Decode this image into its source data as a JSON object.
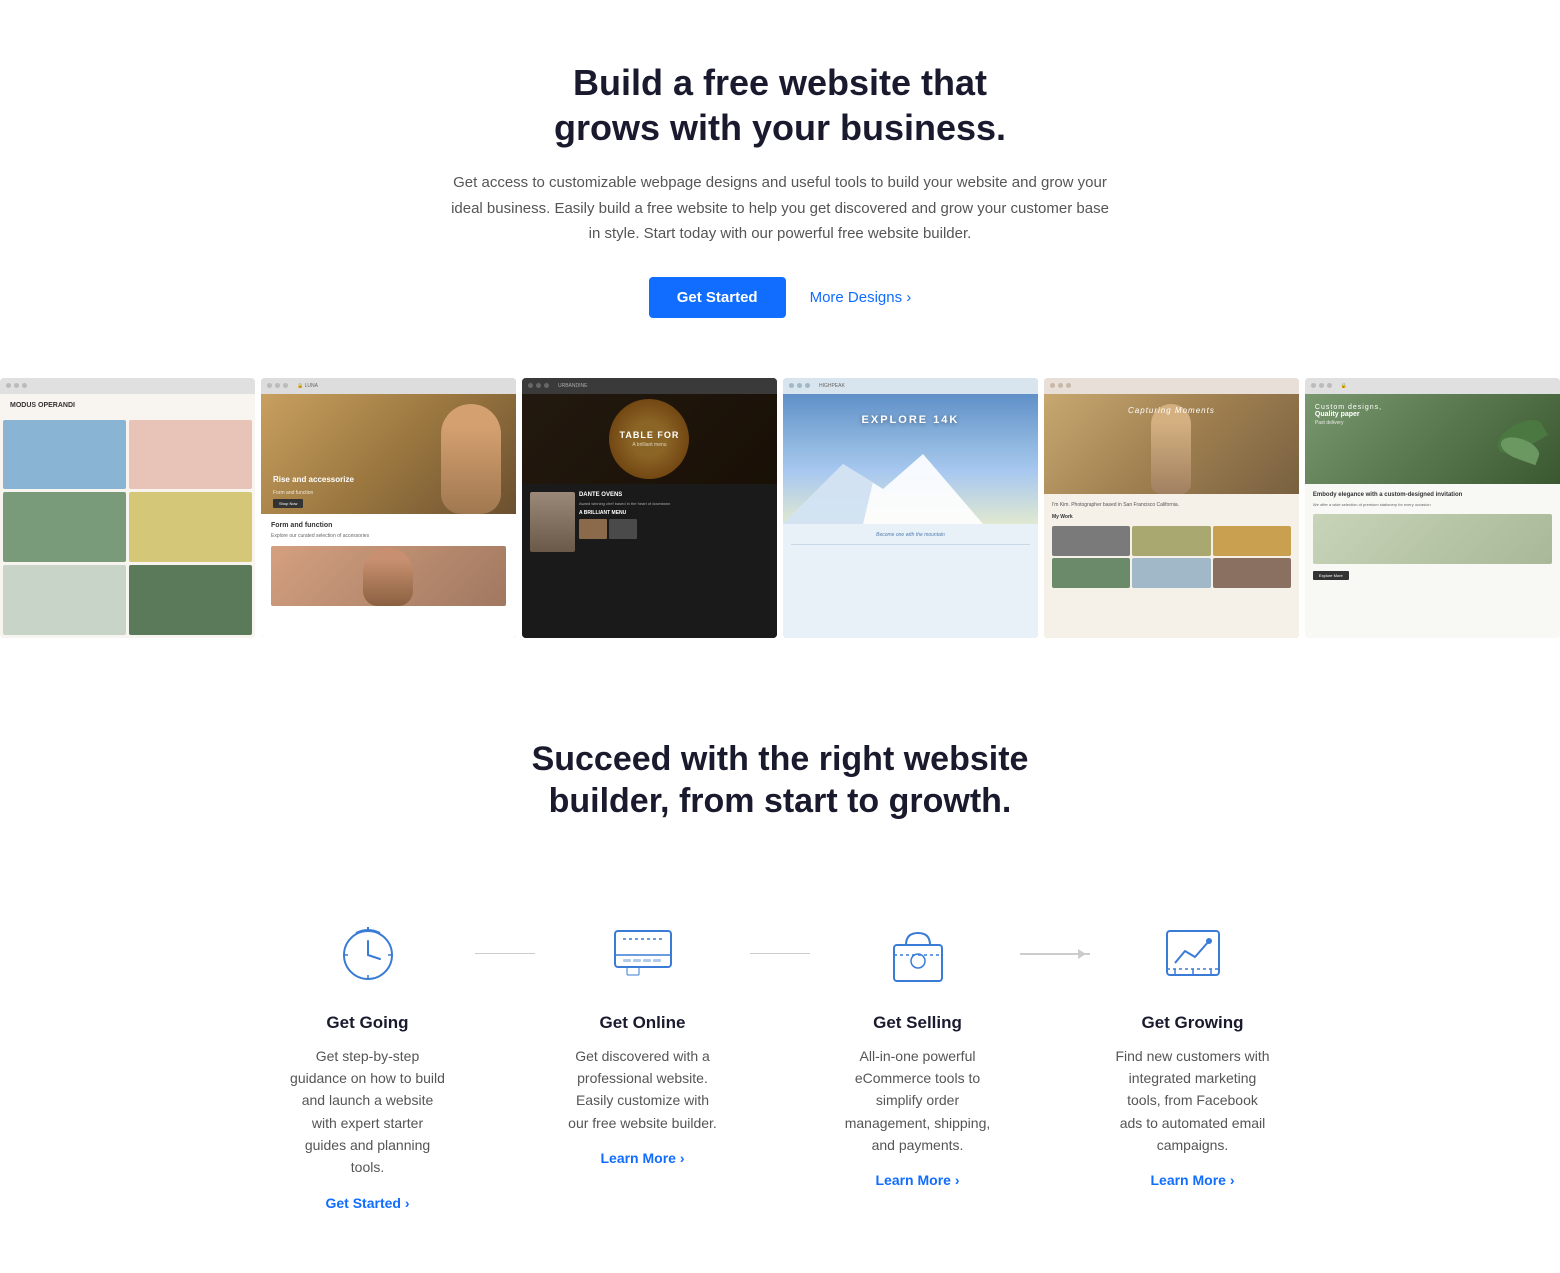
{
  "hero": {
    "title_line1": "Build a free website that",
    "title_line2": "grows with your business.",
    "description": "Get access to customizable webpage designs and useful tools to build your website and grow your ideal business. Easily build a free website to help you get discovered and grow your customer base in style. Start today with our powerful free website builder.",
    "cta_primary": "Get Started",
    "cta_secondary": "More Designs ›"
  },
  "templates": [
    {
      "id": "modus-operandi",
      "name": "Modus Operandi",
      "theme": "tmpl-1"
    },
    {
      "id": "luna",
      "name": "Luna - Rise and accessorize",
      "theme": "tmpl-2"
    },
    {
      "id": "urbandine",
      "name": "Urbandine - Table For",
      "theme": "tmpl-3"
    },
    {
      "id": "highpeak",
      "name": "Highpeak - Explore 14K",
      "theme": "tmpl-4"
    },
    {
      "id": "capturing-moments",
      "name": "Capturing Moments",
      "theme": "tmpl-5"
    },
    {
      "id": "custom-designs",
      "name": "Custom Designs Quality Paper",
      "theme": "tmpl-6"
    }
  ],
  "success_section": {
    "title_line1": "Succeed with the right website",
    "title_line2": "builder, from start to growth."
  },
  "steps": [
    {
      "id": "get-going",
      "title": "Get Going",
      "description": "Get step-by-step guidance on how to build and launch a website with expert starter guides and planning tools.",
      "link": "Get Started ›",
      "icon": "clock-icon",
      "connector": "line"
    },
    {
      "id": "get-online",
      "title": "Get Online",
      "description": "Get discovered with a professional website. Easily customize with our free website builder.",
      "link": "Learn More ›",
      "icon": "computer-icon",
      "connector": "line"
    },
    {
      "id": "get-selling",
      "title": "Get Selling",
      "description": "All-in-one powerful eCommerce tools to simplify order management, shipping, and payments.",
      "link": "Learn More ›",
      "icon": "bag-icon",
      "connector": "arrow"
    },
    {
      "id": "get-growing",
      "title": "Get Growing",
      "description": "Find new customers with integrated marketing tools, from Facebook ads to automated email campaigns.",
      "link": "Learn More ›",
      "icon": "chart-icon",
      "connector": null
    }
  ]
}
